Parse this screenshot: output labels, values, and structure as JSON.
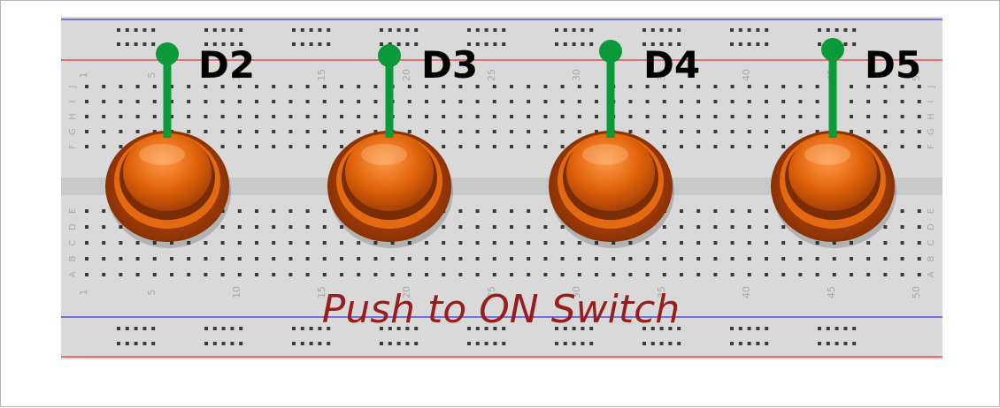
{
  "diagram": {
    "caption": "Push to ON Switch",
    "caption_color": "#9a1c1c",
    "pins": [
      {
        "label": "D2"
      },
      {
        "label": "D3"
      },
      {
        "label": "D4"
      },
      {
        "label": "D5"
      }
    ],
    "board": {
      "column_numbers": [
        "1",
        "5",
        "10",
        "15",
        "20",
        "25",
        "30",
        "35",
        "40",
        "45",
        "50"
      ],
      "row_letters_top": [
        "J",
        "I",
        "H",
        "G",
        "F"
      ],
      "row_letters_bottom": [
        "E",
        "D",
        "C",
        "B",
        "A"
      ]
    },
    "colors": {
      "board": "#d9d9d9",
      "rail_red": "#e05050",
      "rail_blue": "#5050e0",
      "wire": "#0a9a3a",
      "button_cap": "#e0620a",
      "button_base": "#a33c05",
      "text": "#000000"
    },
    "icons": [
      "push-button-icon",
      "jumper-wire-icon",
      "breadboard-icon"
    ]
  }
}
